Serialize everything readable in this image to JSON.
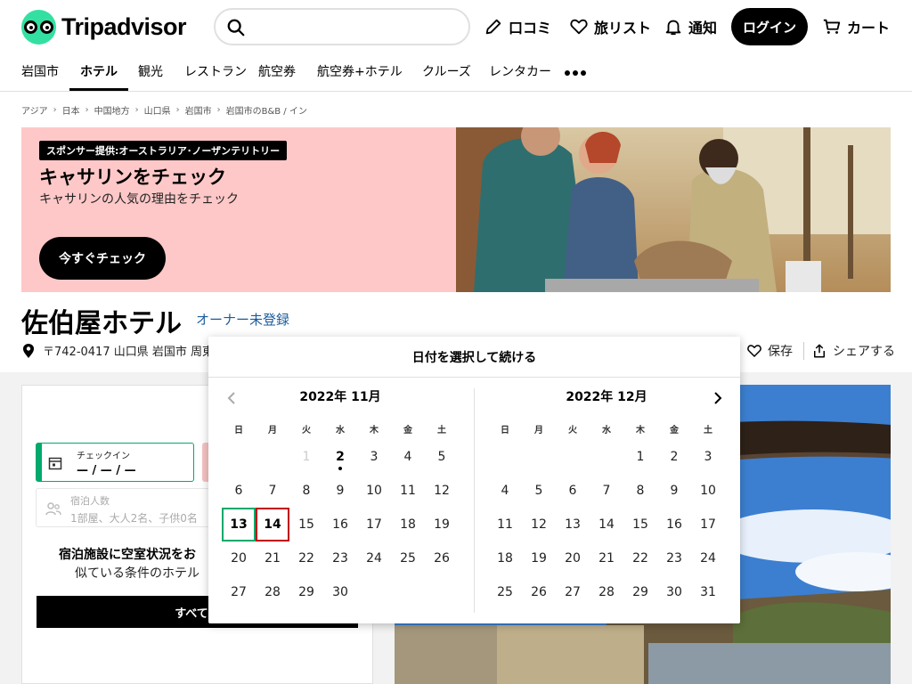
{
  "brand": {
    "name": "Tripadvisor",
    "accent": "#34e0a1"
  },
  "header": {
    "search_placeholder": "",
    "review_label": "口コミ",
    "trips_label": "旅リスト",
    "alerts_label": "通知",
    "login_label": "ログイン",
    "cart_label": "カート"
  },
  "catnav": {
    "items": [
      "岩国市",
      "ホテル",
      "観光",
      "レストラン",
      "航空券",
      "航空券+ホテル",
      "クルーズ",
      "レンタカー"
    ],
    "active_index": 1
  },
  "breadcrumb": [
    "アジア",
    "日本",
    "中国地方",
    "山口県",
    "岩国市",
    "岩国市のB&B / イン"
  ],
  "banner": {
    "sponsor": "スポンサー提供:オーストラリア･ノーザンテリトリー",
    "title": "キャサリンをチェック",
    "subtitle": "キャサリンの人気の理由をチェック",
    "cta": "今すぐチェック",
    "bg_color": "#ffc8c8"
  },
  "hotel": {
    "name": "佐伯屋ホテル",
    "owner_link": "オーナー未登録",
    "address": "〒742-0417 山口県 岩国市 周東",
    "save_label": "保存",
    "share_label": "シェアする"
  },
  "booking": {
    "checkin_label": "チェックイン",
    "checkin_value": "— / — / —",
    "guests_label": "宿泊人数",
    "guests_value": "1部屋、大人2名、子供0名",
    "avail_text": "宿泊施設に空室状況をお",
    "avail_sub": "似ている条件のホテル",
    "show_all": "すべて表"
  },
  "datepicker": {
    "header": "日付を選択して続ける",
    "weekdays": [
      "日",
      "月",
      "火",
      "水",
      "木",
      "金",
      "土"
    ],
    "months": [
      {
        "title": "2022年 11月",
        "weeks": [
          [
            "",
            "",
            "1",
            "2",
            "3",
            "4",
            "5"
          ],
          [
            "6",
            "7",
            "8",
            "9",
            "10",
            "11",
            "12"
          ],
          [
            "13",
            "14",
            "15",
            "16",
            "17",
            "18",
            "19"
          ],
          [
            "20",
            "21",
            "22",
            "23",
            "24",
            "25",
            "26"
          ],
          [
            "27",
            "28",
            "29",
            "30",
            "",
            "",
            ""
          ]
        ],
        "disabled": [
          "1"
        ],
        "today": "2",
        "checkin": "13",
        "checkout": "14"
      },
      {
        "title": "2022年 12月",
        "weeks": [
          [
            "",
            "",
            "",
            "",
            "1",
            "2",
            "3"
          ],
          [
            "4",
            "5",
            "6",
            "7",
            "8",
            "9",
            "10"
          ],
          [
            "11",
            "12",
            "13",
            "14",
            "15",
            "16",
            "17"
          ],
          [
            "18",
            "19",
            "20",
            "21",
            "22",
            "23",
            "24"
          ],
          [
            "25",
            "26",
            "27",
            "28",
            "29",
            "30",
            "31"
          ]
        ],
        "disabled": [],
        "today": "",
        "checkin": "",
        "checkout": ""
      }
    ]
  }
}
